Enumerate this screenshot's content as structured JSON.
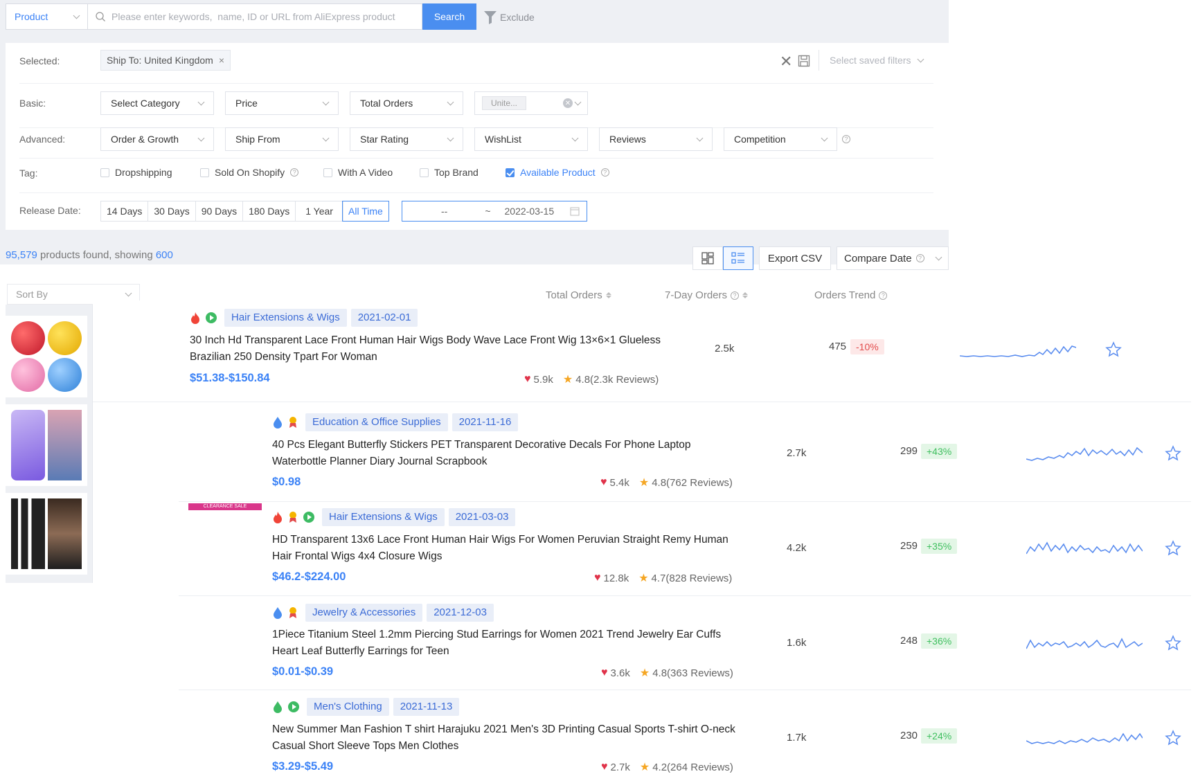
{
  "search": {
    "type_label": "Product",
    "placeholder": "Please enter keywords,  name, ID or URL from AliExpress product",
    "button": "Search",
    "exclude": "Exclude"
  },
  "filters": {
    "selected_label": "Selected:",
    "selected_chip": "Ship To: United Kingdom",
    "saved_placeholder": "Select saved filters",
    "basic_label": "Basic:",
    "basic": [
      "Select Category",
      "Price",
      "Total Orders",
      "Unite..."
    ],
    "advanced_label": "Advanced:",
    "advanced": [
      "Order & Growth",
      "Ship From",
      "Star Rating",
      "WishList",
      "Reviews",
      "Competition"
    ],
    "tag_label": "Tag:",
    "tags": [
      {
        "label": "Dropshipping",
        "checked": false
      },
      {
        "label": "Sold On Shopify",
        "checked": false
      },
      {
        "label": "With A Video",
        "checked": false
      },
      {
        "label": "Top Brand",
        "checked": false
      },
      {
        "label": "Available Product",
        "checked": true
      }
    ],
    "release_label": "Release Date:",
    "release_options": [
      "14 Days",
      "30 Days",
      "90 Days",
      "180 Days",
      "1 Year",
      "All Time"
    ],
    "release_active": "All Time",
    "date_from": "--",
    "date_sep": "~",
    "date_to": "2022-03-15"
  },
  "results": {
    "count": "95,579",
    "middle": " products found, showing ",
    "showing": "600",
    "export": "Export CSV",
    "compare": "Compare Date"
  },
  "list_header": {
    "sort_by": "Sort By",
    "total_orders": "Total Orders",
    "seven_day": "7-Day Orders",
    "trend": "Orders Trend"
  },
  "products": [
    {
      "category": "Hair Extensions & Wigs",
      "date": "2021-02-01",
      "title_1": "30 Inch Hd Transparent Lace Front Human Hair Wigs Body Wave Lace Front Wig 13×6×1 Glueless",
      "title_2": "Brazilian 250 Density Tpart For Woman",
      "price": "$51.38-$150.84",
      "wishlist": "5.9k",
      "rating": "4.8(2.3k Reviews)",
      "total_orders": "2.5k",
      "seven_day": "475",
      "change": "-10%",
      "change_dir": "neg",
      "badges": [
        "fire-icon",
        "play-icon"
      ]
    },
    {
      "category": "Education & Office Supplies",
      "date": "2021-11-16",
      "title_1": "40 Pcs Elegant Butterfly Stickers PET Transparent Decorative Decals For Phone Laptop",
      "title_2": "Waterbottle Planner Diary Journal Scrapbook",
      "price": "$0.98",
      "wishlist": "5.4k",
      "rating": "4.8(762 Reviews)",
      "total_orders": "2.7k",
      "seven_day": "299",
      "change": "+43%",
      "change_dir": "pos",
      "badges": [
        "drop-icon",
        "medal-icon"
      ]
    },
    {
      "category": "Hair Extensions & Wigs",
      "date": "2021-03-03",
      "title_1": "HD Transparent 13x6 Lace Front Human Hair Wigs For Women Peruvian Straight Remy Human",
      "title_2": "Hair Frontal Wigs 4x4 Closure Wigs",
      "price": "$46.2-$224.00",
      "wishlist": "12.8k",
      "rating": "4.7(828 Reviews)",
      "total_orders": "4.2k",
      "seven_day": "259",
      "change": "+35%",
      "change_dir": "pos",
      "badges": [
        "fire-icon",
        "medal-icon",
        "play-icon"
      ],
      "image_caption": "CLEARANCE SALE"
    },
    {
      "category": "Jewelry & Accessories",
      "date": "2021-12-03",
      "title_1": "1Piece Titanium Steel 1.2mm Piercing Stud Earrings for Women 2021 Trend Jewelry Ear Cuffs",
      "title_2": "Heart Leaf Butterfly Earrings for Teen",
      "price": "$0.01-$0.39",
      "wishlist": "3.6k",
      "rating": "4.8(363 Reviews)",
      "total_orders": "1.6k",
      "seven_day": "248",
      "change": "+36%",
      "change_dir": "pos",
      "badges": [
        "drop-icon",
        "medal-icon"
      ]
    },
    {
      "category": "Men's Clothing",
      "date": "2021-11-13",
      "title_1": "New Summer Man Fashion T shirt Harajuku 2021 Men's 3D Printing Casual Sports T-shirt O-neck",
      "title_2": "Casual Short Sleeve Tops Men Clothes",
      "price": "$3.29-$5.49",
      "wishlist": "2.7k",
      "rating": "4.2(264 Reviews)",
      "total_orders": "1.7k",
      "seven_day": "230",
      "change": "+24%",
      "change_dir": "pos",
      "badges": [
        "leaf-icon",
        "play-icon"
      ]
    }
  ],
  "colors": {
    "accent": "#4a8ef0",
    "neg_bg": "#fde8e8",
    "neg_fg": "#e24b4b",
    "pos_bg": "#e3f6e6",
    "pos_fg": "#3fbf5f",
    "spark": "#5b8def"
  }
}
